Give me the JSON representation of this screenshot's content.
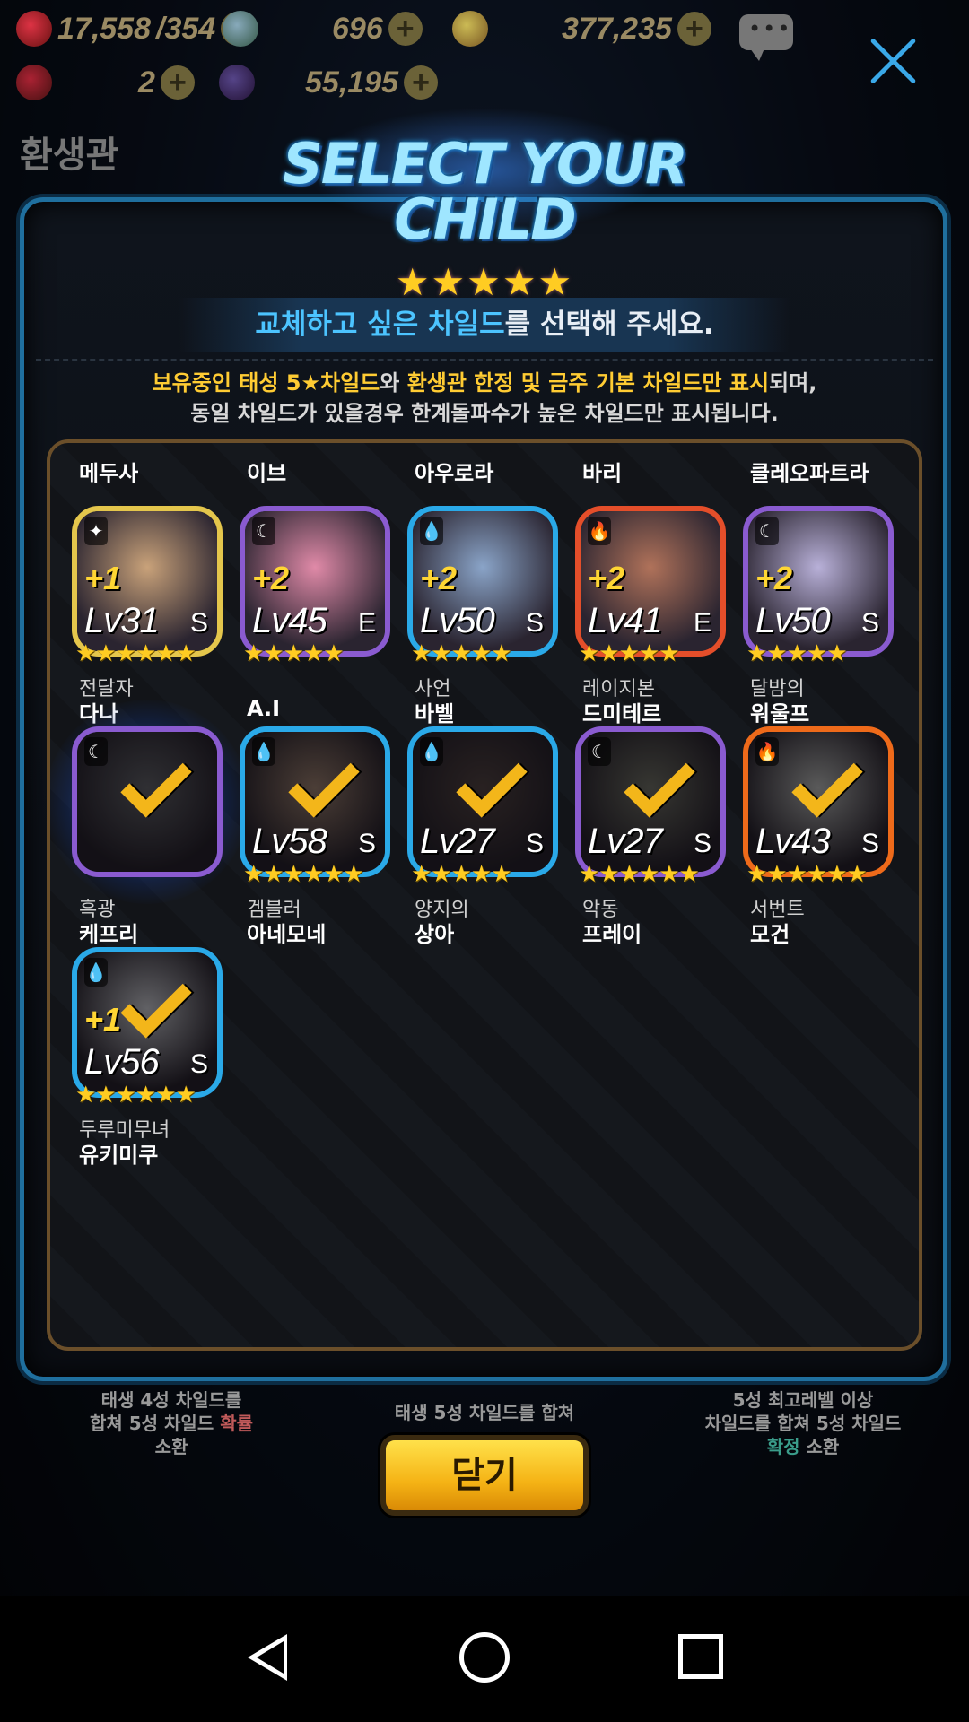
{
  "resources": {
    "hearts": "17,558",
    "hearts_max": "/354",
    "gems": "696",
    "gold": "377,235",
    "ruby": "2",
    "orbs": "55,195"
  },
  "background": {
    "title": "환생관",
    "cards": [
      {
        "l1": "태생 4성 차일드를",
        "l2a": "합쳐 5성 차일드 ",
        "l2b": "확률",
        "l3": "소환"
      },
      {
        "l1": "태생 5성 차일드를 합쳐"
      },
      {
        "l1": "5성 최고레벨 이상",
        "l2": "차일드를 합쳐 5성 차일드",
        "l3a": "확정",
        "l3b": " 소환"
      }
    ]
  },
  "dialog": {
    "title": "Select your Child",
    "title_stars": "★★★★★",
    "instruction_hl": "교체하고 싶은 차일드",
    "instruction_rest": "를 선택해 주세요.",
    "notice_a": "보유중인 태성 5★차일드",
    "notice_b": "와 ",
    "notice_c": "환생관 한정 및 금주 기본 차일드만 표시",
    "notice_d": "되며,",
    "notice_line2": "동일 차일드가 있을경우 한계돌파수가 높은 차일드만 표시됩니다.",
    "close_label": "닫기"
  },
  "children_top_row": [
    {
      "title": "Ⅹ",
      "name": "메두사"
    },
    {
      "title": "Ⅹ",
      "name": "이브"
    },
    {
      "title": "Ⅹ",
      "name": "아우로라"
    },
    {
      "title": "Ⅹ",
      "name": "바리"
    },
    {
      "title": "Ⅹ",
      "name": "클레오파트라"
    }
  ],
  "children": [
    {
      "title": "전달자",
      "name": "다나",
      "plus": "+1",
      "level": "Lv31",
      "grade": "S",
      "stars": "★★★★★★",
      "element": "✦",
      "frame": "gold",
      "checked": false,
      "selected": false
    },
    {
      "title": "",
      "name": "A.I",
      "plus": "+2",
      "level": "Lv45",
      "grade": "E",
      "stars": "★★★★★",
      "element": "☾",
      "frame": "purple",
      "checked": false,
      "selected": false
    },
    {
      "title": "사언",
      "name": "바벨",
      "plus": "+2",
      "level": "Lv50",
      "grade": "S",
      "stars": "★★★★★",
      "element": "💧",
      "frame": "blue",
      "checked": false,
      "selected": false
    },
    {
      "title": "레이지본",
      "name": "드미테르",
      "plus": "+2",
      "level": "Lv41",
      "grade": "E",
      "stars": "★★★★★",
      "element": "🔥",
      "frame": "red",
      "checked": false,
      "selected": false
    },
    {
      "title": "달밤의",
      "name": "워울프",
      "plus": "+2",
      "level": "Lv50",
      "grade": "S",
      "stars": "★★★★★",
      "element": "☾",
      "frame": "purple",
      "checked": false,
      "selected": false
    },
    {
      "title": "흑광",
      "name": "케프리",
      "plus": "",
      "level": "",
      "grade": "",
      "stars": "",
      "element": "☾",
      "frame": "purple",
      "checked": true,
      "selected": true
    },
    {
      "title": "겜블러",
      "name": "아네모네",
      "plus": "",
      "level": "Lv58",
      "grade": "S",
      "stars": "★★★★★★",
      "element": "💧",
      "frame": "blue",
      "checked": true,
      "selected": false
    },
    {
      "title": "양지의",
      "name": "상아",
      "plus": "",
      "level": "Lv27",
      "grade": "S",
      "stars": "★★★★★",
      "element": "💧",
      "frame": "blue",
      "checked": true,
      "selected": false
    },
    {
      "title": "악동",
      "name": "프레이",
      "plus": "",
      "level": "Lv27",
      "grade": "S",
      "stars": "★★★★★★",
      "element": "☾",
      "frame": "purple",
      "checked": true,
      "selected": false
    },
    {
      "title": "서번트",
      "name": "모건",
      "plus": "",
      "level": "Lv43",
      "grade": "S",
      "stars": "★★★★★★",
      "element": "🔥",
      "frame": "orange",
      "checked": true,
      "selected": false
    },
    {
      "title": "두루미무녀",
      "name": "유키미쿠",
      "plus": "+1",
      "level": "Lv56",
      "grade": "S",
      "stars": "★★★★★★",
      "element": "💧",
      "frame": "blue",
      "checked": true,
      "selected": false
    }
  ],
  "portrait_colors": [
    "#c9a27a",
    "#e08aa8",
    "#8aa4c8",
    "#b0725a",
    "#b8b0d8",
    "#6a6a72",
    "#a88a7a",
    "#5a4a4a",
    "#7a7a70",
    "#c8c8c8",
    "#d8d8e0"
  ]
}
